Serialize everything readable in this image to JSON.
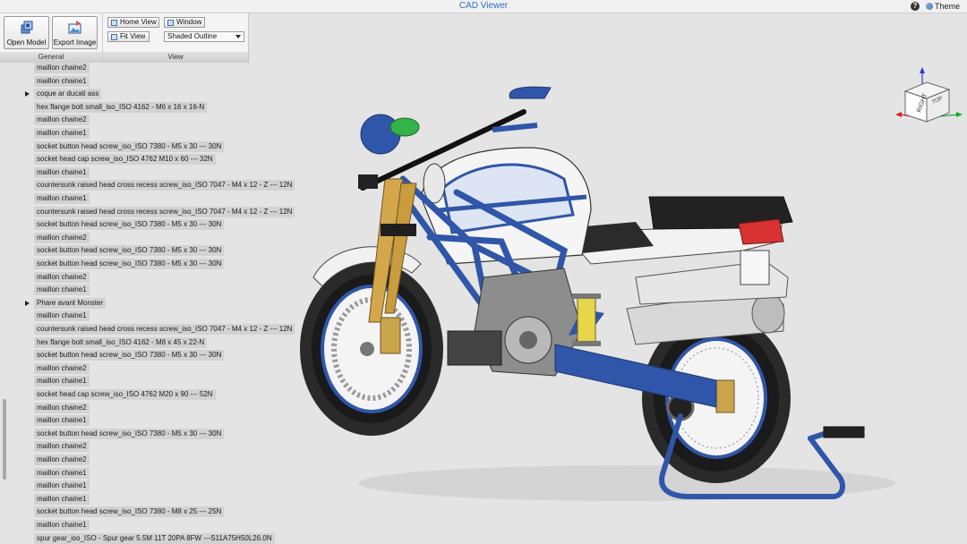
{
  "app": {
    "title": "CAD Viewer",
    "help_symbol": "?",
    "theme_label": "Theme"
  },
  "ribbon": {
    "general": {
      "label": "General",
      "open_model": "Open Model",
      "export_image": "Export Image"
    },
    "view": {
      "label": "View",
      "home_view": "Home View",
      "window": "Window",
      "fit_view": "Fit View",
      "display_mode": "Shaded Outline"
    }
  },
  "tree": {
    "items": [
      {
        "label": "maillon chaine2",
        "expandable": false
      },
      {
        "label": "maillon chaine1",
        "expandable": false
      },
      {
        "label": "coque ar ducati ass",
        "expandable": true
      },
      {
        "label": "hex flange bolt small_iso_ISO 4162 - M6 x 16 x 16-N",
        "expandable": false
      },
      {
        "label": "maillon chaine2",
        "expandable": false
      },
      {
        "label": "maillon chaine1",
        "expandable": false
      },
      {
        "label": "socket button head screw_iso_ISO 7380 - M5 x 30 --- 30N",
        "expandable": false
      },
      {
        "label": "socket head cap screw_iso_ISO 4762 M10 x 60 --- 32N",
        "expandable": false
      },
      {
        "label": "maillon chaine1",
        "expandable": false
      },
      {
        "label": "countersunk raised head cross recess screw_iso_ISO 7047 - M4 x 12 - Z --- 12N",
        "expandable": false
      },
      {
        "label": "maillon chaine1",
        "expandable": false
      },
      {
        "label": "countersunk raised head cross recess screw_iso_ISO 7047 - M4 x 12 - Z --- 12N",
        "expandable": false
      },
      {
        "label": "socket button head screw_iso_ISO 7380 - M5 x 30 --- 30N",
        "expandable": false
      },
      {
        "label": "maillon chaine2",
        "expandable": false
      },
      {
        "label": "socket button head screw_iso_ISO 7380 - M5 x 30 --- 30N",
        "expandable": false
      },
      {
        "label": "socket button head screw_iso_ISO 7380 - M5 x 30 --- 30N",
        "expandable": false
      },
      {
        "label": "maillon chaine2",
        "expandable": false
      },
      {
        "label": "maillon chaine1",
        "expandable": false
      },
      {
        "label": "Phare avant Monster",
        "expandable": true
      },
      {
        "label": "maillon chaine1",
        "expandable": false
      },
      {
        "label": "countersunk raised head cross recess screw_iso_ISO 7047 - M4 x 12 - Z --- 12N",
        "expandable": false
      },
      {
        "label": "hex flange bolt small_iso_ISO 4162 - M8 x 45 x 22-N",
        "expandable": false
      },
      {
        "label": "socket button head screw_iso_ISO 7380 - M5 x 30 --- 30N",
        "expandable": false
      },
      {
        "label": "maillon chaine2",
        "expandable": false
      },
      {
        "label": "maillon chaine1",
        "expandable": false
      },
      {
        "label": "socket head cap screw_iso_ISO 4762 M20 x 90 --- 52N",
        "expandable": false
      },
      {
        "label": "maillon chaine2",
        "expandable": false
      },
      {
        "label": "maillon chaine1",
        "expandable": false
      },
      {
        "label": "socket button head screw_iso_ISO 7380 - M5 x 30 --- 30N",
        "expandable": false
      },
      {
        "label": "maillon chaine2",
        "expandable": false
      },
      {
        "label": "maillon chaine2",
        "expandable": false
      },
      {
        "label": "maillon chaine1",
        "expandable": false
      },
      {
        "label": "maillon chaine1",
        "expandable": false
      },
      {
        "label": "maillon chaine1",
        "expandable": false
      },
      {
        "label": "socket button head screw_iso_ISO 7380 - M8 x 25 --- 25N",
        "expandable": false
      },
      {
        "label": "maillon chaine1",
        "expandable": false
      },
      {
        "label": "spur gear_iso_ISO - Spur gear 5.5M 11T 20PA 8FW ---S11A75H50L26.0N",
        "expandable": false
      }
    ]
  },
  "view_cube": {
    "face_right": "RIGHT",
    "face_top": "TOP"
  },
  "colors": {
    "accent": "#2f6fbf",
    "frame_blue": "#2f56a8",
    "background": "#e4e4e4"
  }
}
